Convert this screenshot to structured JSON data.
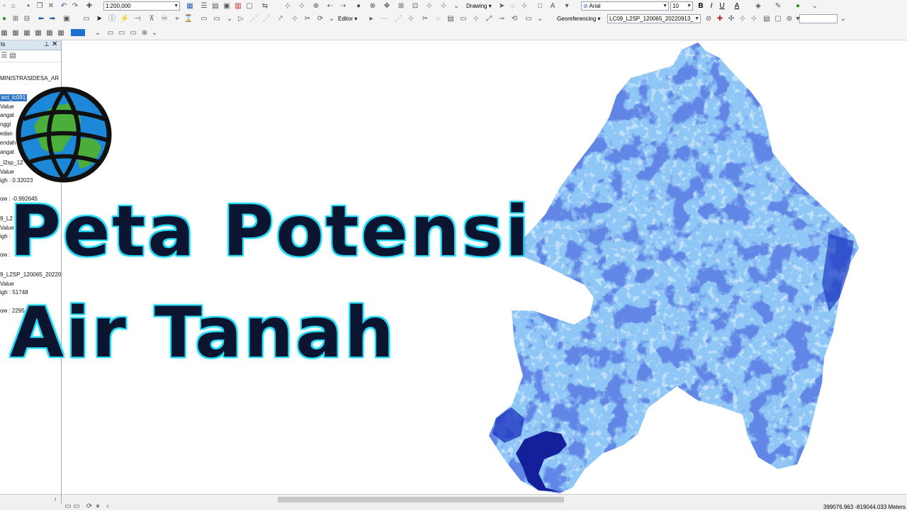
{
  "toolbar": {
    "scale_value": "1:200,000",
    "drawing_label": "Drawing",
    "font_value": "Arial",
    "font_size_value": "10",
    "bold_label": "B",
    "italic_label": "I",
    "underline_label": "U",
    "font_color_label": "A",
    "editor_label": "Editor",
    "georeferencing_label": "Georeferencing",
    "layer_value": "LC09_L2SP_120065_20220913_",
    "search_value": ""
  },
  "toc": {
    "title": "ts",
    "rows": [
      "MINISTRASIDESA_AR",
      "ect_lc091",
      "Value",
      "angat",
      "nggi",
      "edan",
      "endah",
      "angat",
      "_l2sp_12",
      "Value",
      "igh : 0.32023",
      "ow : -0.992645",
      "9_L2",
      "Value",
      "igh :",
      "ow :",
      "9_L2SP_120065_20220",
      "Value",
      "igh : 51748",
      "ow : 2295"
    ]
  },
  "overlay": {
    "title_line1": "Peta Potensi",
    "title_line2": "Air Tanah"
  },
  "status": {
    "coordinates": "399076.963  -819044.033 Meters"
  },
  "colors": {
    "map_light": "#8ec6f6",
    "map_mid": "#4a86e8",
    "map_dark": "#1f3cc4",
    "title_fill": "#0b1530",
    "title_glow": "#24d4f0"
  }
}
